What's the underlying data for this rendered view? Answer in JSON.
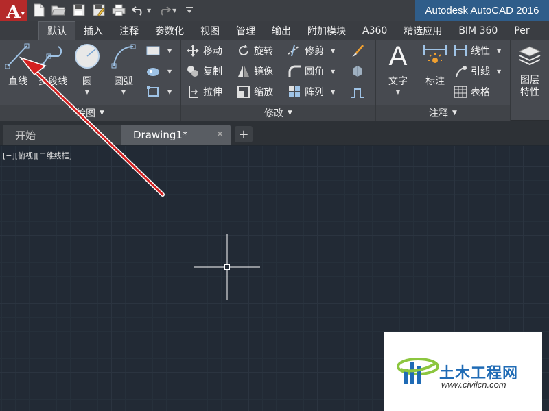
{
  "app": {
    "title": "Autodesk AutoCAD 2016",
    "logo_letter": "A",
    "accent": "#b52a2a"
  },
  "quick_access": [
    {
      "name": "new-icon"
    },
    {
      "name": "open-icon"
    },
    {
      "name": "save-icon"
    },
    {
      "name": "save-as-icon"
    },
    {
      "name": "print-icon"
    },
    {
      "name": "undo-icon"
    },
    {
      "name": "redo-icon"
    },
    {
      "name": "customize-icon"
    }
  ],
  "ribbon_tabs": [
    "默认",
    "插入",
    "注释",
    "参数化",
    "视图",
    "管理",
    "输出",
    "附加模块",
    "A360",
    "精选应用",
    "BIM 360",
    "Per"
  ],
  "active_tab": "默认",
  "panels": {
    "draw": {
      "title": "绘图",
      "line": "直线",
      "polyline": "多段线",
      "circle": "圆",
      "arc": "圆弧"
    },
    "modify": {
      "title": "修改",
      "move": "移动",
      "rotate": "旋转",
      "trim": "修剪",
      "copy": "复制",
      "mirror": "镜像",
      "fillet": "圆角",
      "stretch": "拉伸",
      "scale": "缩放",
      "array": "阵列"
    },
    "annotation": {
      "title": "注释",
      "text": "文字",
      "dimension": "标注",
      "linear": "线性",
      "leader": "引线",
      "table": "表格"
    },
    "layers": {
      "properties_line1": "图层",
      "properties_line2": "特性"
    }
  },
  "file_tabs": {
    "start": "开始",
    "drawing": "Drawing1*",
    "close_glyph": "✕",
    "new_glyph": "+"
  },
  "viewport_controls": "[−][俯视][二维线框]",
  "watermark": {
    "title": "土木工程网",
    "url": "www.civilcn.com"
  },
  "colors": {
    "annotation_arrow": "#d42020",
    "title_highlight": "#2f5d8a",
    "canvas": "#222a35"
  }
}
